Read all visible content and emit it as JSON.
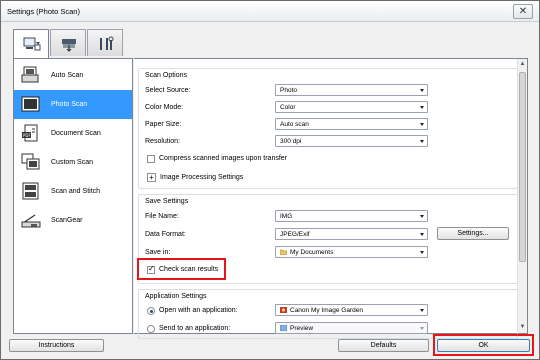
{
  "window": {
    "title": "Settings (Photo Scan)",
    "close_label": "✕"
  },
  "tabs": [
    {
      "icon": "scan-from-computer-icon",
      "active": true
    },
    {
      "icon": "scan-from-panel-icon",
      "active": false
    },
    {
      "icon": "general-settings-icon",
      "active": false
    }
  ],
  "sidebar": {
    "items": [
      {
        "label": "Auto Scan",
        "icon": "auto-scan-icon"
      },
      {
        "label": "Photo Scan",
        "icon": "photo-scan-icon"
      },
      {
        "label": "Document Scan",
        "icon": "document-scan-icon"
      },
      {
        "label": "Custom Scan",
        "icon": "custom-scan-icon"
      },
      {
        "label": "Scan and Stitch",
        "icon": "scan-and-stitch-icon"
      },
      {
        "label": "ScanGear",
        "icon": "scangear-icon"
      }
    ]
  },
  "scan_options": {
    "title": "Scan Options",
    "select_source": {
      "label": "Select Source:",
      "value": "Photo"
    },
    "color_mode": {
      "label": "Color Mode:",
      "value": "Color"
    },
    "paper_size": {
      "label": "Paper Size:",
      "value": "Auto scan"
    },
    "resolution": {
      "label": "Resolution:",
      "value": "300 dpi"
    },
    "compress_label": "Compress scanned images upon transfer",
    "image_processing_label": "Image Processing Settings"
  },
  "save_settings": {
    "title": "Save Settings",
    "file_name": {
      "label": "File Name:",
      "value": "IMG"
    },
    "data_format": {
      "label": "Data Format:",
      "value": "JPEG/Exif"
    },
    "settings_button": "Settings...",
    "save_in": {
      "label": "Save in:",
      "value": "My Documents"
    },
    "check_scan_results_label": "Check scan results"
  },
  "application_settings": {
    "title": "Application Settings",
    "open_with": {
      "label": "Open with an application:",
      "value": "Canon My Image Garden"
    },
    "send_to": {
      "label": "Send to an application:",
      "value": "Preview"
    }
  },
  "footer": {
    "instructions": "Instructions",
    "defaults": "Defaults",
    "ok": "OK"
  },
  "colors": {
    "selection": "#3399ff",
    "highlight": "#e8161b"
  }
}
